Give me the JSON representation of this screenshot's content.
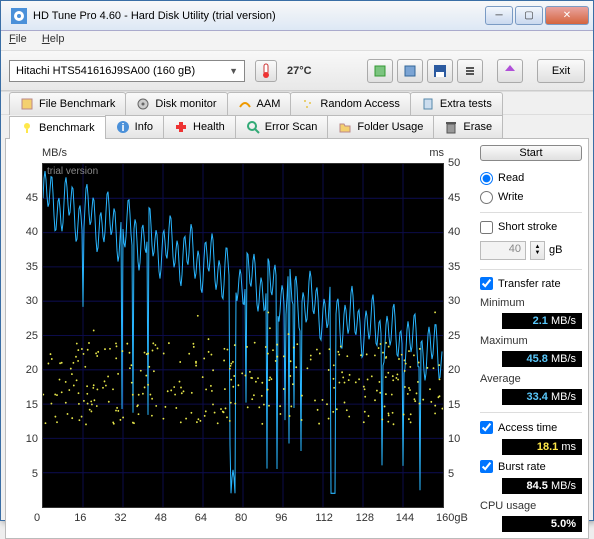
{
  "window": {
    "title": "HD Tune Pro 4.60 - Hard Disk Utility (trial version)"
  },
  "menu": {
    "file": "File",
    "help": "Help"
  },
  "toolbar": {
    "drive": "Hitachi HTS541616J9SA00 (160 gB)",
    "temp": "27°C",
    "exit": "Exit"
  },
  "tabs_top": [
    {
      "icon": "file-bench-icon",
      "label": "File Benchmark"
    },
    {
      "icon": "disk-monitor-icon",
      "label": "Disk monitor"
    },
    {
      "icon": "aam-icon",
      "label": "AAM"
    },
    {
      "icon": "random-access-icon",
      "label": "Random Access"
    },
    {
      "icon": "extra-tests-icon",
      "label": "Extra tests"
    }
  ],
  "tabs_main": [
    {
      "icon": "benchmark-icon",
      "label": "Benchmark",
      "active": true
    },
    {
      "icon": "info-icon",
      "label": "Info"
    },
    {
      "icon": "health-icon",
      "label": "Health"
    },
    {
      "icon": "error-scan-icon",
      "label": "Error Scan"
    },
    {
      "icon": "folder-usage-icon",
      "label": "Folder Usage"
    },
    {
      "icon": "erase-icon",
      "label": "Erase"
    }
  ],
  "side": {
    "start": "Start",
    "read": "Read",
    "write": "Write",
    "short_stroke": "Short stroke",
    "stroke_val": "40",
    "stroke_unit": "gB",
    "transfer_rate": "Transfer rate",
    "min_label": "Minimum",
    "min_val": "2.1",
    "min_unit": "MB/s",
    "max_label": "Maximum",
    "max_val": "45.8",
    "max_unit": "MB/s",
    "avg_label": "Average",
    "avg_val": "33.4",
    "avg_unit": "MB/s",
    "acc_label": "Access time",
    "acc_val": "18.1",
    "acc_unit": "ms",
    "burst_label": "Burst rate",
    "burst_val": "84.5",
    "burst_unit": "MB/s",
    "cpu_label": "CPU usage",
    "cpu_val": "5.0%"
  },
  "chart": {
    "left_unit": "MB/s",
    "right_unit": "ms",
    "watermark": "trial version",
    "y_left": [
      5,
      10,
      15,
      20,
      25,
      30,
      35,
      40,
      45
    ],
    "y_right": [
      5,
      10,
      15,
      20,
      25,
      30,
      35,
      40,
      45,
      50
    ],
    "x": [
      "0",
      "16",
      "32",
      "48",
      "64",
      "80",
      "96",
      "112",
      "128",
      "144",
      "160gB"
    ]
  },
  "chart_data": {
    "type": "line+scatter",
    "title": "",
    "x_range": [
      0,
      160
    ],
    "y_left_range": [
      0,
      50
    ],
    "y_right_range": [
      0,
      50
    ],
    "left_ylabel": "MB/s",
    "right_ylabel": "ms",
    "xlabel": "gB",
    "series": [
      {
        "name": "Transfer rate",
        "axis": "left",
        "type": "line",
        "color": "#29b6ff",
        "x": [
          0,
          4,
          8,
          12,
          16,
          20,
          24,
          28,
          32,
          36,
          40,
          44,
          48,
          52,
          56,
          60,
          64,
          68,
          72,
          76,
          80,
          84,
          88,
          92,
          96,
          100,
          104,
          108,
          112,
          116,
          120,
          124,
          128,
          132,
          136,
          140,
          144,
          148,
          152,
          156,
          160
        ],
        "values": [
          44,
          45,
          44,
          45,
          44,
          44,
          43,
          43,
          42,
          43,
          42,
          41,
          41,
          40,
          40,
          39,
          39,
          38,
          38,
          37,
          37,
          36,
          36,
          35,
          35,
          34,
          33,
          33,
          32,
          31,
          30,
          30,
          29,
          28,
          27,
          27,
          26,
          25,
          25,
          23,
          22
        ],
        "notes": "Highly oscillating trace; many downward spikes to ~20 and a few to ~2 (e.g. near x≈76,116). Values above are upper envelope."
      },
      {
        "name": "Access time",
        "axis": "right",
        "type": "scatter",
        "color": "#e6e64a",
        "approx_band": {
          "min": 9,
          "max": 25,
          "mean": 18.1
        },
        "notes": "Dense scatter of ~300 points roughly uniform across x, concentrated 14–22 ms with outliers 9–30."
      }
    ],
    "summary": {
      "transfer_min": 2.1,
      "transfer_max": 45.8,
      "transfer_avg": 33.4,
      "access_time_ms": 18.1,
      "burst_rate": 84.5,
      "cpu_pct": 5.0
    }
  }
}
